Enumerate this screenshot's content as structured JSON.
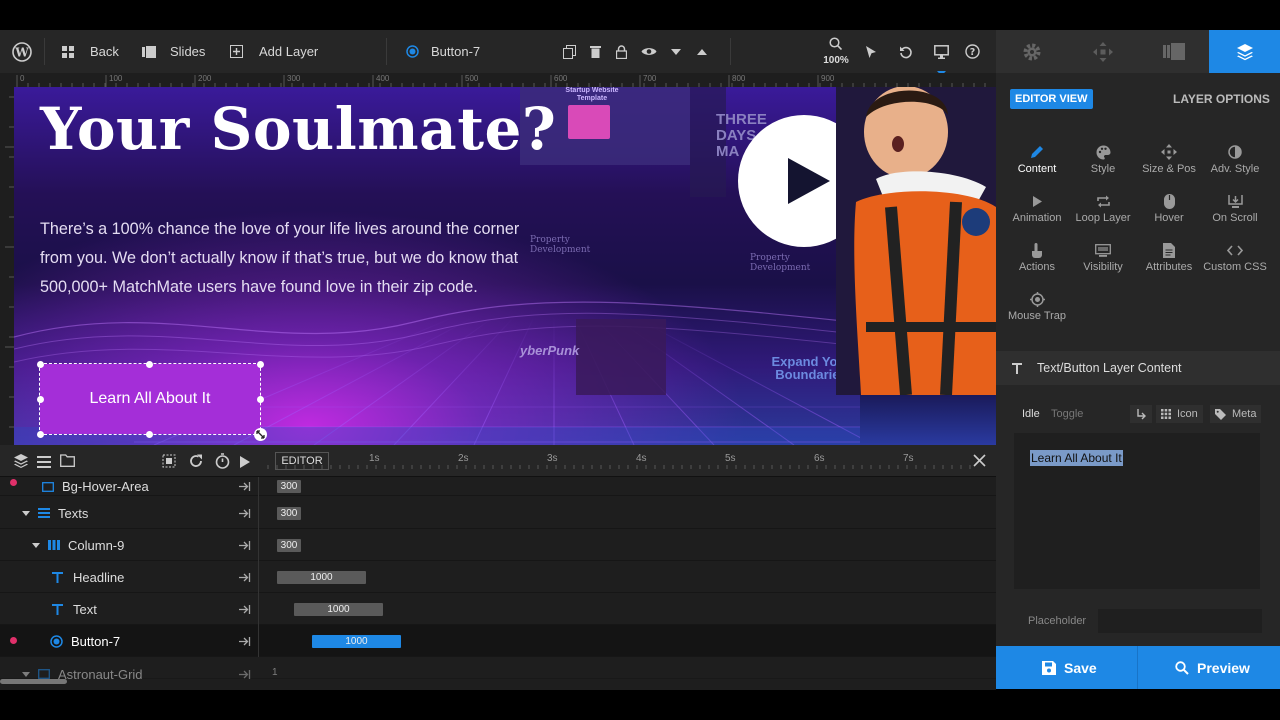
{
  "toolbar": {
    "back": "Back",
    "slides": "Slides",
    "add_layer": "Add Layer",
    "current_layer": "Button-7",
    "zoom": "100%"
  },
  "ruler_ticks": [
    "0",
    "100",
    "200",
    "300",
    "400",
    "500",
    "600",
    "700",
    "800",
    "900"
  ],
  "canvas": {
    "headline": "Your Soulmate?",
    "body": "There’s a 100% chance the love of your life lives around the corner from you. We don’t actually know if that’s true, but we do know that 500,000+ MatchMate users have found love in their zip code.",
    "button": "Learn All About It",
    "thumb_texts": [
      "Startup Website Template",
      "THREE DAYS MA",
      "Property Development",
      "Property Development",
      "yberPunk",
      "Expand Your Boundaries"
    ]
  },
  "timeline": {
    "editor_tab": "EDITOR",
    "seconds": [
      "1s",
      "2s",
      "3s",
      "4s",
      "5s",
      "6s",
      "7s"
    ],
    "rows": [
      {
        "name": "Bg-Hover-Area",
        "bar": "300",
        "dot": true
      },
      {
        "name": "Texts",
        "bar": "300",
        "dot": false
      },
      {
        "name": "Column-9",
        "bar": "300",
        "dot": false
      },
      {
        "name": "Headline",
        "bar": "1000",
        "dot": false
      },
      {
        "name": "Text",
        "bar": "1000",
        "dot": false
      },
      {
        "name": "Button-7",
        "bar": "1000",
        "dot": true
      },
      {
        "name": "Astronaut-Grid",
        "bar": "1",
        "dot": false
      }
    ]
  },
  "panel": {
    "editor_view": "EDITOR VIEW",
    "layer_options": "LAYER OPTIONS",
    "options": [
      "Content",
      "Style",
      "Size & Pos",
      "Adv. Style",
      "Animation",
      "Loop Layer",
      "Hover",
      "On Scroll",
      "Actions",
      "Visibility",
      "Attributes",
      "Custom CSS",
      "Mouse Trap"
    ],
    "section_title": "Text/Button Layer Content",
    "idle": "Idle",
    "toggle": "Toggle",
    "icon": "Icon",
    "meta": "Meta",
    "content_value": "Learn All About It",
    "placeholder_label": "Placeholder"
  },
  "footer": {
    "save": "Save",
    "preview": "Preview"
  },
  "colors": {
    "accent": "#1e88e5",
    "button": "#a42ed8",
    "dot": "#e0306a"
  }
}
